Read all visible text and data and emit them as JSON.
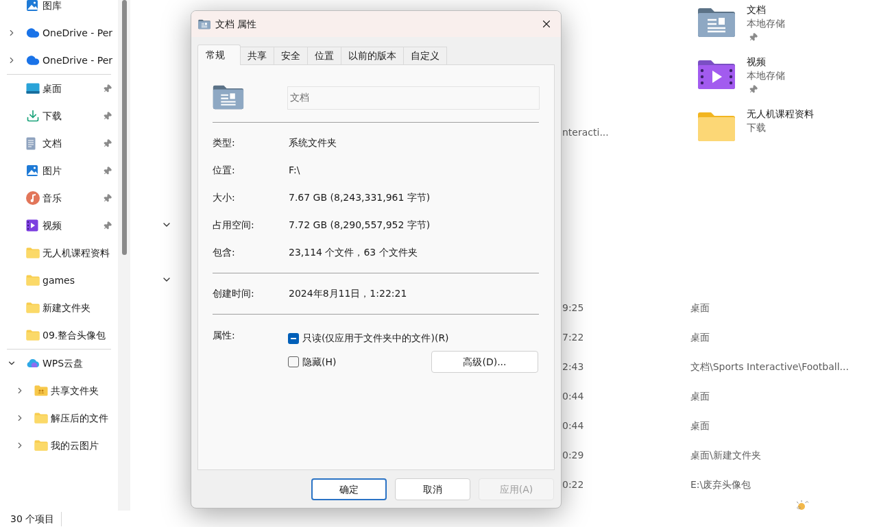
{
  "sidebar": {
    "groups": [
      {
        "items": [
          {
            "label": "图库",
            "kind": "gallery"
          },
          {
            "label": "OneDrive - Per",
            "kind": "cloud",
            "expanded": false
          },
          {
            "label": "OneDrive - Per",
            "kind": "cloud",
            "expanded": false
          }
        ]
      },
      {
        "items": [
          {
            "label": "桌面",
            "kind": "desktop",
            "pinned": true
          },
          {
            "label": "下载",
            "kind": "download",
            "pinned": true
          },
          {
            "label": "文档",
            "kind": "documents",
            "pinned": true
          },
          {
            "label": "图片",
            "kind": "pictures",
            "pinned": true
          },
          {
            "label": "音乐",
            "kind": "music",
            "pinned": true
          },
          {
            "label": "视频",
            "kind": "videos",
            "pinned": true
          },
          {
            "label": "无人机课程资料",
            "kind": "folder",
            "pinned": false
          },
          {
            "label": "games",
            "kind": "folder",
            "pinned": false
          },
          {
            "label": "新建文件夹",
            "kind": "folder",
            "pinned": false
          },
          {
            "label": "09.整合头像包",
            "kind": "folder",
            "pinned": false
          }
        ]
      },
      {
        "items": [
          {
            "label": "WPS云盘",
            "kind": "cloud-color",
            "expanded": true,
            "children": [
              {
                "label": "共享文件夹",
                "kind": "shared-folder",
                "expanded": false
              },
              {
                "label": "解压后的文件",
                "kind": "folder",
                "expanded": false
              },
              {
                "label": "我的云图片",
                "kind": "folder",
                "expanded": false
              }
            ]
          }
        ]
      }
    ]
  },
  "quick_access": [
    {
      "name": "文档",
      "location": "本地存储",
      "kind": "documents",
      "pinned": true
    },
    {
      "name": "视频",
      "location": "本地存储",
      "kind": "videos",
      "pinned": true
    },
    {
      "name": "无人机课程资料",
      "location": "下载",
      "kind": "folder",
      "pinned": false
    }
  ],
  "behind_fragment": "nteracti...",
  "recent": [
    {
      "time": "9:25",
      "location": "桌面"
    },
    {
      "time": "7:22",
      "location": "桌面"
    },
    {
      "time": "2:43",
      "location": "文档\\Sports Interactive\\Football..."
    },
    {
      "time": "0:44",
      "location": "桌面"
    },
    {
      "time": "0:44",
      "location": "桌面"
    },
    {
      "time": "0:29",
      "location": "桌面\\新建文件夹"
    },
    {
      "time": "0:22",
      "location": "E:\\废弃头像包"
    }
  ],
  "status_bar": "30 个项目",
  "dialog": {
    "title": "文档 属性",
    "tabs": [
      {
        "label": "常规",
        "selected": true
      },
      {
        "label": "共享",
        "selected": false
      },
      {
        "label": "安全",
        "selected": false
      },
      {
        "label": "位置",
        "selected": false
      },
      {
        "label": "以前的版本",
        "selected": false
      },
      {
        "label": "自定义",
        "selected": false
      }
    ],
    "name_field": "文档",
    "info": [
      {
        "label": "类型:",
        "value": "系统文件夹"
      },
      {
        "label": "位置:",
        "value": "F:\\"
      },
      {
        "label": "大小:",
        "value": "7.67 GB (8,243,331,961 字节)"
      },
      {
        "label": "占用空间:",
        "value": "7.72 GB (8,290,557,952 字节)"
      },
      {
        "label": "包含:",
        "value": "23,114 个文件，63 个文件夹"
      }
    ],
    "created": {
      "label": "创建时间:",
      "value": "2024年8月11日，1:22:21"
    },
    "attributes_label": "属性:",
    "attributes": [
      {
        "label": "只读(仅应用于文件夹中的文件)(R)",
        "checked": true,
        "indeterminate": true
      },
      {
        "label": "隐藏(H)",
        "checked": false,
        "indeterminate": false
      }
    ],
    "advanced_button": "高级(D)...",
    "buttons": [
      {
        "label": "确定",
        "default": true,
        "disabled": false
      },
      {
        "label": "取消",
        "default": false,
        "disabled": false
      },
      {
        "label": "应用(A)",
        "default": false,
        "disabled": true
      }
    ]
  }
}
